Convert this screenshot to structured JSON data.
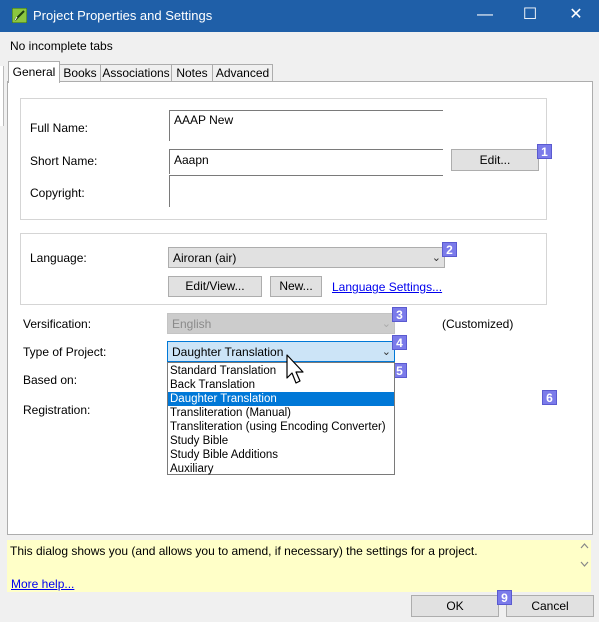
{
  "window": {
    "title": "Project Properties and Settings",
    "minimize_glyph": "—",
    "maximize_glyph": "☐",
    "close_glyph": "✕"
  },
  "status_message": "No incomplete tabs",
  "tabs": [
    {
      "label": "General",
      "active": true
    },
    {
      "label": "Books",
      "active": false
    },
    {
      "label": "Associations",
      "active": false
    },
    {
      "label": "Notes",
      "active": false
    },
    {
      "label": "Advanced",
      "active": false
    }
  ],
  "general": {
    "full_name": {
      "label": "Full Name:",
      "value": "AAAP New"
    },
    "short_name": {
      "label": "Short Name:",
      "value": "Aaapn"
    },
    "copyright": {
      "label": "Copyright:",
      "value": ""
    },
    "edit_button": "Edit...",
    "language": {
      "label": "Language:",
      "value": "Airoran (air)"
    },
    "edit_view_button": "Edit/View...",
    "new_button": "New...",
    "language_settings_link": "Language Settings...",
    "versification": {
      "label": "Versification:",
      "value": "English",
      "note": "(Customized)"
    },
    "type_of_project": {
      "label": "Type of Project:",
      "value": "Daughter Translation"
    },
    "based_on": {
      "label": "Based on:"
    },
    "registration": {
      "label": "Registration:"
    },
    "project_type_options": [
      "Standard Translation",
      "Back Translation",
      "Daughter Translation",
      "Transliteration (Manual)",
      "Transliteration (using Encoding Converter)",
      "Study Bible",
      "Study Bible Additions",
      "Auxiliary"
    ],
    "selected_option_index": 2
  },
  "badges": [
    "1",
    "2",
    "3",
    "4",
    "5",
    "6",
    "9"
  ],
  "help": {
    "text": "This dialog shows you (and allows you to amend, if necessary) the settings for a project.",
    "more_help_link": "More help..."
  },
  "buttons": {
    "ok": "OK",
    "cancel": "Cancel"
  },
  "colors": {
    "titlebar": "#1f5fa8",
    "badge": "#7b7bea",
    "selection": "#0078d7",
    "help_background": "#ffffc8",
    "link": "#0000ee"
  },
  "icons": {
    "app_icon": "project-app-icon",
    "combo_arrow": "chevron-down-icon",
    "cursor": "mouse-pointer-icon"
  }
}
